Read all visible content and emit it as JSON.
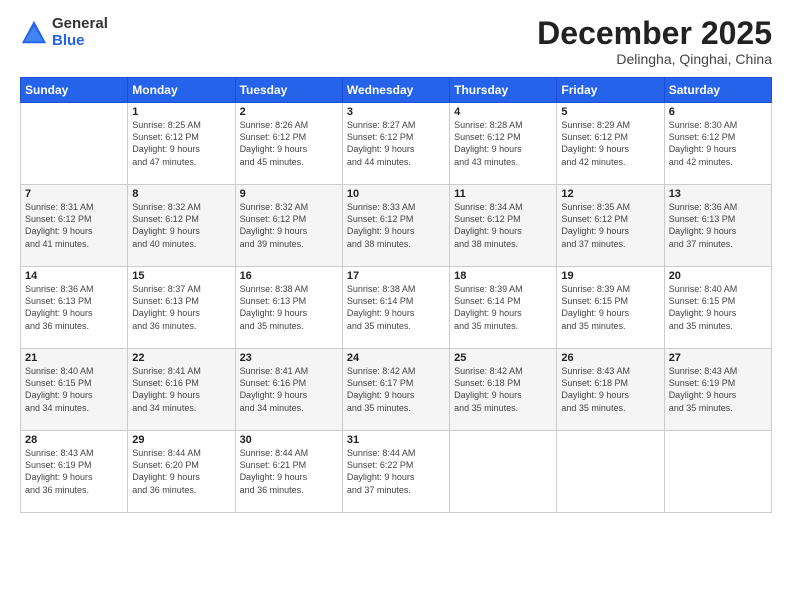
{
  "logo": {
    "general": "General",
    "blue": "Blue"
  },
  "title": "December 2025",
  "subtitle": "Delingha, Qinghai, China",
  "weekdays": [
    "Sunday",
    "Monday",
    "Tuesday",
    "Wednesday",
    "Thursday",
    "Friday",
    "Saturday"
  ],
  "weeks": [
    [
      {
        "day": "",
        "info": ""
      },
      {
        "day": "1",
        "info": "Sunrise: 8:25 AM\nSunset: 6:12 PM\nDaylight: 9 hours\nand 47 minutes."
      },
      {
        "day": "2",
        "info": "Sunrise: 8:26 AM\nSunset: 6:12 PM\nDaylight: 9 hours\nand 45 minutes."
      },
      {
        "day": "3",
        "info": "Sunrise: 8:27 AM\nSunset: 6:12 PM\nDaylight: 9 hours\nand 44 minutes."
      },
      {
        "day": "4",
        "info": "Sunrise: 8:28 AM\nSunset: 6:12 PM\nDaylight: 9 hours\nand 43 minutes."
      },
      {
        "day": "5",
        "info": "Sunrise: 8:29 AM\nSunset: 6:12 PM\nDaylight: 9 hours\nand 42 minutes."
      },
      {
        "day": "6",
        "info": "Sunrise: 8:30 AM\nSunset: 6:12 PM\nDaylight: 9 hours\nand 42 minutes."
      }
    ],
    [
      {
        "day": "7",
        "info": "Sunrise: 8:31 AM\nSunset: 6:12 PM\nDaylight: 9 hours\nand 41 minutes."
      },
      {
        "day": "8",
        "info": "Sunrise: 8:32 AM\nSunset: 6:12 PM\nDaylight: 9 hours\nand 40 minutes."
      },
      {
        "day": "9",
        "info": "Sunrise: 8:32 AM\nSunset: 6:12 PM\nDaylight: 9 hours\nand 39 minutes."
      },
      {
        "day": "10",
        "info": "Sunrise: 8:33 AM\nSunset: 6:12 PM\nDaylight: 9 hours\nand 38 minutes."
      },
      {
        "day": "11",
        "info": "Sunrise: 8:34 AM\nSunset: 6:12 PM\nDaylight: 9 hours\nand 38 minutes."
      },
      {
        "day": "12",
        "info": "Sunrise: 8:35 AM\nSunset: 6:12 PM\nDaylight: 9 hours\nand 37 minutes."
      },
      {
        "day": "13",
        "info": "Sunrise: 8:36 AM\nSunset: 6:13 PM\nDaylight: 9 hours\nand 37 minutes."
      }
    ],
    [
      {
        "day": "14",
        "info": "Sunrise: 8:36 AM\nSunset: 6:13 PM\nDaylight: 9 hours\nand 36 minutes."
      },
      {
        "day": "15",
        "info": "Sunrise: 8:37 AM\nSunset: 6:13 PM\nDaylight: 9 hours\nand 36 minutes."
      },
      {
        "day": "16",
        "info": "Sunrise: 8:38 AM\nSunset: 6:13 PM\nDaylight: 9 hours\nand 35 minutes."
      },
      {
        "day": "17",
        "info": "Sunrise: 8:38 AM\nSunset: 6:14 PM\nDaylight: 9 hours\nand 35 minutes."
      },
      {
        "day": "18",
        "info": "Sunrise: 8:39 AM\nSunset: 6:14 PM\nDaylight: 9 hours\nand 35 minutes."
      },
      {
        "day": "19",
        "info": "Sunrise: 8:39 AM\nSunset: 6:15 PM\nDaylight: 9 hours\nand 35 minutes."
      },
      {
        "day": "20",
        "info": "Sunrise: 8:40 AM\nSunset: 6:15 PM\nDaylight: 9 hours\nand 35 minutes."
      }
    ],
    [
      {
        "day": "21",
        "info": "Sunrise: 8:40 AM\nSunset: 6:15 PM\nDaylight: 9 hours\nand 34 minutes."
      },
      {
        "day": "22",
        "info": "Sunrise: 8:41 AM\nSunset: 6:16 PM\nDaylight: 9 hours\nand 34 minutes."
      },
      {
        "day": "23",
        "info": "Sunrise: 8:41 AM\nSunset: 6:16 PM\nDaylight: 9 hours\nand 34 minutes."
      },
      {
        "day": "24",
        "info": "Sunrise: 8:42 AM\nSunset: 6:17 PM\nDaylight: 9 hours\nand 35 minutes."
      },
      {
        "day": "25",
        "info": "Sunrise: 8:42 AM\nSunset: 6:18 PM\nDaylight: 9 hours\nand 35 minutes."
      },
      {
        "day": "26",
        "info": "Sunrise: 8:43 AM\nSunset: 6:18 PM\nDaylight: 9 hours\nand 35 minutes."
      },
      {
        "day": "27",
        "info": "Sunrise: 8:43 AM\nSunset: 6:19 PM\nDaylight: 9 hours\nand 35 minutes."
      }
    ],
    [
      {
        "day": "28",
        "info": "Sunrise: 8:43 AM\nSunset: 6:19 PM\nDaylight: 9 hours\nand 36 minutes."
      },
      {
        "day": "29",
        "info": "Sunrise: 8:44 AM\nSunset: 6:20 PM\nDaylight: 9 hours\nand 36 minutes."
      },
      {
        "day": "30",
        "info": "Sunrise: 8:44 AM\nSunset: 6:21 PM\nDaylight: 9 hours\nand 36 minutes."
      },
      {
        "day": "31",
        "info": "Sunrise: 8:44 AM\nSunset: 6:22 PM\nDaylight: 9 hours\nand 37 minutes."
      },
      {
        "day": "",
        "info": ""
      },
      {
        "day": "",
        "info": ""
      },
      {
        "day": "",
        "info": ""
      }
    ]
  ]
}
